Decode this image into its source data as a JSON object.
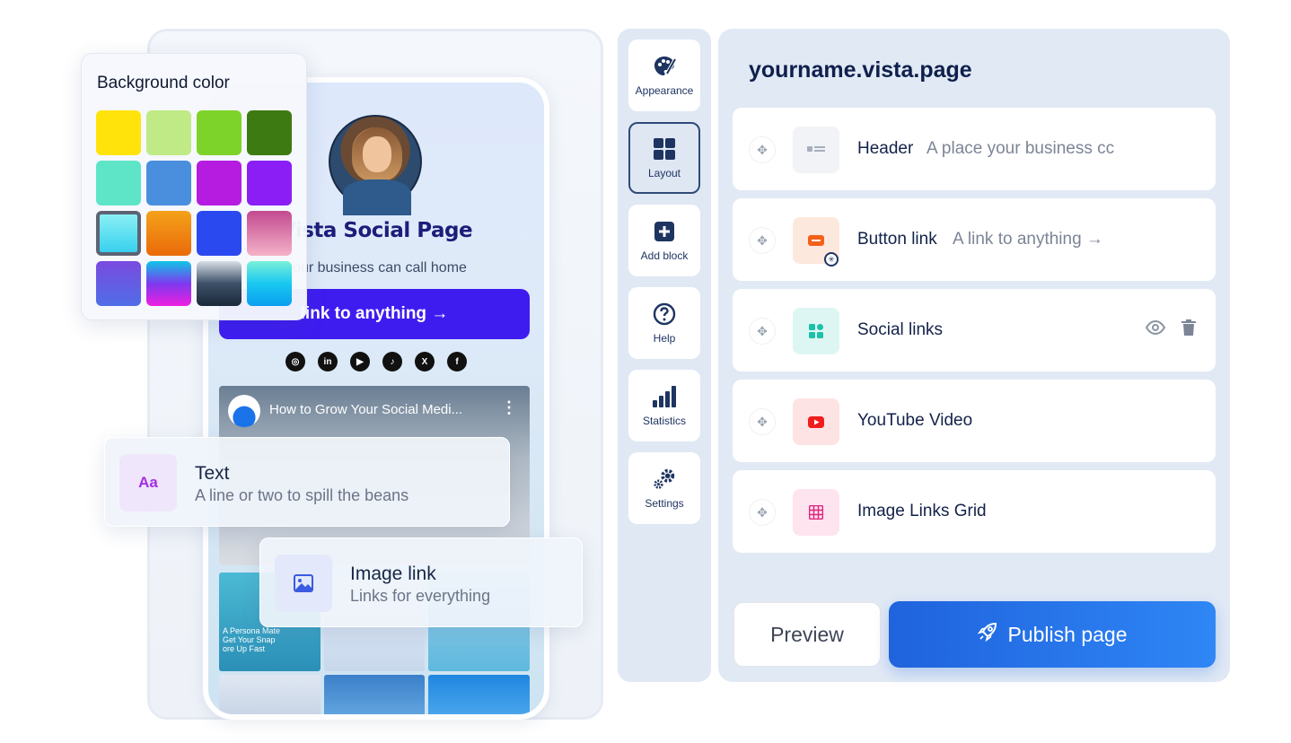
{
  "background_color_panel": {
    "title": "Background color",
    "swatches": [
      "#ffe30a",
      "#bfea86",
      "#7ed32a",
      "#3e7a12",
      "#5ee5c8",
      "#4a8ede",
      "#b51ce0",
      "#8a1ef5",
      "#4be0ee",
      "#f07c10",
      "#2a4af0",
      "#d6609e",
      "#6c5ae0",
      "#b33ee6",
      "#5e6e82",
      "#1ec8ee"
    ],
    "selected_index": 8
  },
  "phone_preview": {
    "title": "Vista Social Page",
    "subtitle": "your business can call home",
    "cta_label": "link to anything →",
    "socials": [
      "instagram",
      "linkedin",
      "youtube",
      "tiktok",
      "x",
      "facebook"
    ],
    "video_title": "How to Grow Your Social Medi...",
    "tile_text": "A Persona Mate\nGet Your Snap\nore Up Fast"
  },
  "floating_cards": {
    "text": {
      "icon": "Aa",
      "title": "Text",
      "subtitle": "A line or two to spill the beans"
    },
    "image_link": {
      "title": "Image link",
      "subtitle": "Links for everything"
    }
  },
  "sidebar": {
    "items": [
      {
        "label": "Appearance",
        "icon": "palette-icon",
        "active": false
      },
      {
        "label": "Layout",
        "icon": "grid-icon",
        "active": true
      },
      {
        "label": "Add block",
        "icon": "plus-square-icon",
        "active": false
      },
      {
        "label": "Help",
        "icon": "question-icon",
        "active": false
      },
      {
        "label": "Statistics",
        "icon": "bar-chart-icon",
        "active": false
      },
      {
        "label": "Settings",
        "icon": "gear-icon",
        "active": false
      }
    ]
  },
  "editor": {
    "page_url": "yourname.vista.page",
    "blocks": [
      {
        "name": "Header",
        "description": "A place your business cc",
        "icon": "header-icon",
        "icon_bg": "#f1f3f7"
      },
      {
        "name": "Button link",
        "description": "A link to anything →",
        "icon": "button-icon",
        "icon_bg": "#fde8dd"
      },
      {
        "name": "Social links",
        "description": "",
        "icon": "social-grid-icon",
        "icon_bg": "#def6f3"
      },
      {
        "name": "YouTube Video",
        "description": "",
        "icon": "youtube-icon",
        "icon_bg": "#fde3e3"
      },
      {
        "name": "Image Links Grid",
        "description": "",
        "icon": "image-grid-icon",
        "icon_bg": "#fde4ef"
      }
    ],
    "preview_label": "Preview",
    "publish_label": "Publish page"
  },
  "colors": {
    "accent": "#2f86f5",
    "cta": "#3e1cf0",
    "title": "#0f1f4d"
  }
}
